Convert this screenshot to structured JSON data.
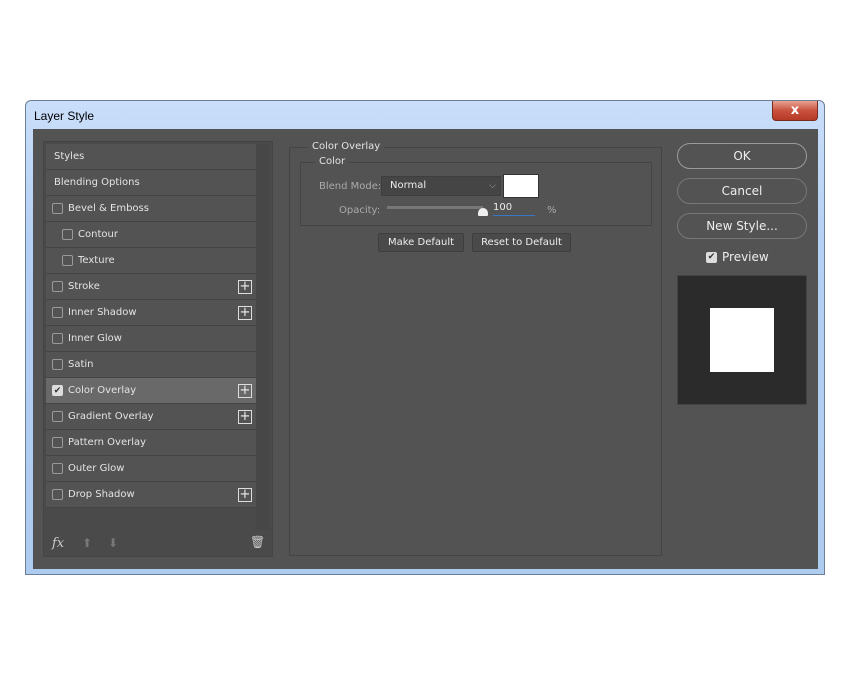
{
  "window": {
    "title": "Layer Style",
    "close_label": "x"
  },
  "styles_list": [
    {
      "label": "Styles",
      "checkbox": false,
      "indent": false,
      "checked": false,
      "plus": false
    },
    {
      "label": "Blending Options",
      "checkbox": false,
      "indent": false,
      "checked": false,
      "plus": false
    },
    {
      "label": "Bevel & Emboss",
      "checkbox": true,
      "indent": false,
      "checked": false,
      "plus": false
    },
    {
      "label": "Contour",
      "checkbox": true,
      "indent": true,
      "checked": false,
      "plus": false
    },
    {
      "label": "Texture",
      "checkbox": true,
      "indent": true,
      "checked": false,
      "plus": false
    },
    {
      "label": "Stroke",
      "checkbox": true,
      "indent": false,
      "checked": false,
      "plus": true
    },
    {
      "label": "Inner Shadow",
      "checkbox": true,
      "indent": false,
      "checked": false,
      "plus": true
    },
    {
      "label": "Inner Glow",
      "checkbox": true,
      "indent": false,
      "checked": false,
      "plus": false
    },
    {
      "label": "Satin",
      "checkbox": true,
      "indent": false,
      "checked": false,
      "plus": false
    },
    {
      "label": "Color Overlay",
      "checkbox": true,
      "indent": false,
      "checked": true,
      "plus": true,
      "selected": true
    },
    {
      "label": "Gradient Overlay",
      "checkbox": true,
      "indent": false,
      "checked": false,
      "plus": true
    },
    {
      "label": "Pattern Overlay",
      "checkbox": true,
      "indent": false,
      "checked": false,
      "plus": false
    },
    {
      "label": "Outer Glow",
      "checkbox": true,
      "indent": false,
      "checked": false,
      "plus": false
    },
    {
      "label": "Drop Shadow",
      "checkbox": true,
      "indent": false,
      "checked": false,
      "plus": true
    }
  ],
  "footer": {
    "fx_label": "fx"
  },
  "panel": {
    "title": "Color Overlay",
    "group": "Color",
    "blend_mode_label": "Blend Mode:",
    "blend_mode": "Normal",
    "overlay_color": "#ffffff",
    "opacity_label": "Opacity:",
    "opacity": "100",
    "opacity_unit": "%",
    "opacity_fraction": 1.0,
    "make_default": "Make Default",
    "reset_default": "Reset to Default"
  },
  "buttons": {
    "ok": "OK",
    "cancel": "Cancel",
    "new_style": "New Style...",
    "preview": "Preview",
    "preview_checked": true
  }
}
